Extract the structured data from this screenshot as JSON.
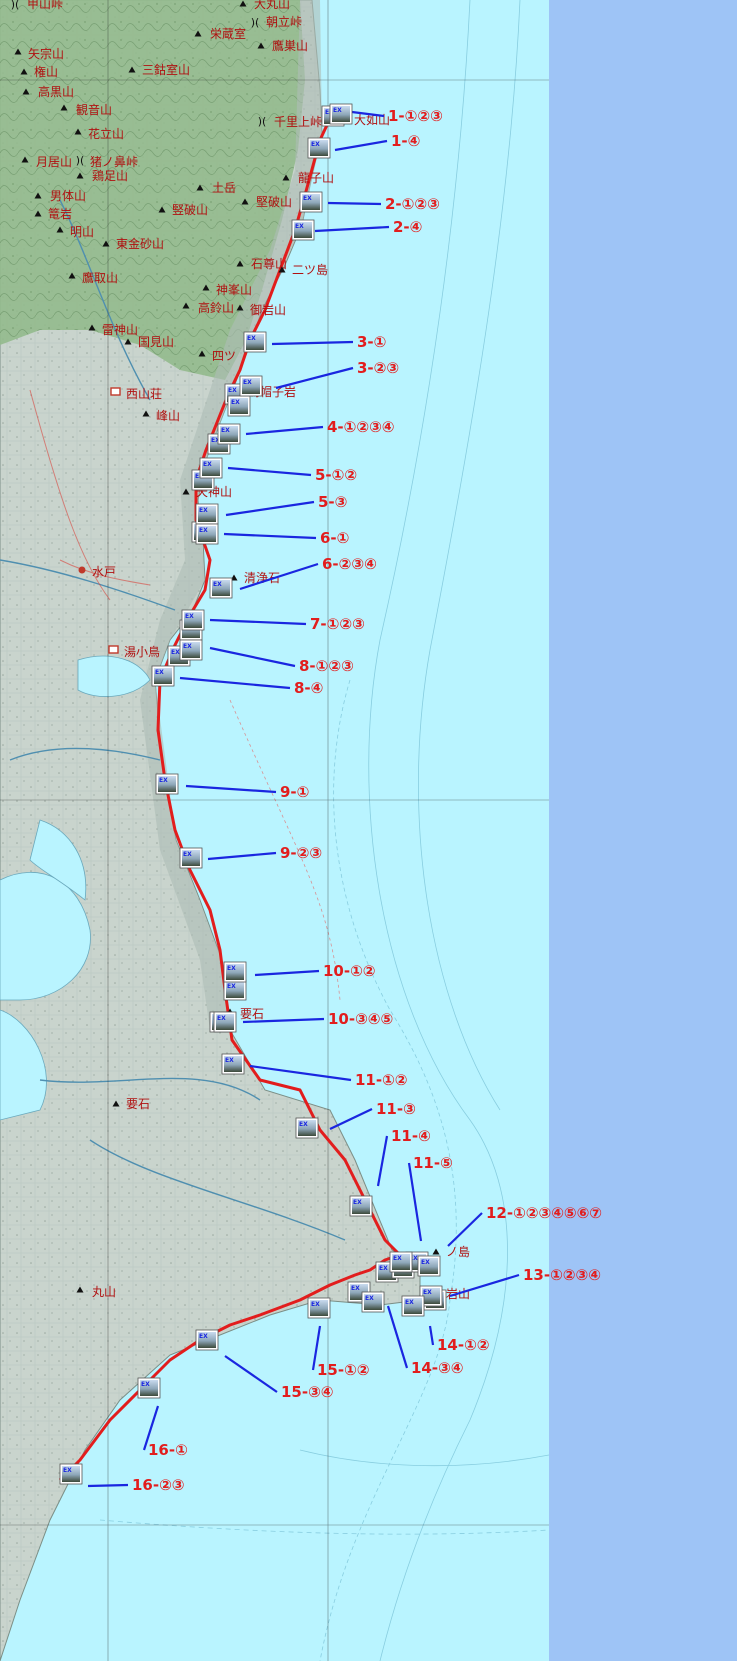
{
  "colors": {
    "ocean": "#b9f4ff",
    "side_panel": "#9ec4f6",
    "land": "#c6d2cc",
    "mountains": "#8fb889",
    "route": "#e21d1d",
    "leader": "#1a26e0",
    "label": "#e21d1d",
    "place": "#b01010"
  },
  "route_legs": [
    {
      "label": "1-①②③"
    },
    {
      "label": "1-④"
    },
    {
      "label": "2-①②③"
    },
    {
      "label": "2-④"
    },
    {
      "label": "3-①"
    },
    {
      "label": "3-②③"
    },
    {
      "label": "4-①②③④"
    },
    {
      "label": "5-①②"
    },
    {
      "label": "5-③"
    },
    {
      "label": "6-①"
    },
    {
      "label": "6-②③④"
    },
    {
      "label": "7-①②③"
    },
    {
      "label": "8-①②③"
    },
    {
      "label": "8-④"
    },
    {
      "label": "9-①"
    },
    {
      "label": "9-②③"
    },
    {
      "label": "10-①②"
    },
    {
      "label": "10-③④⑤"
    },
    {
      "label": "11-①②"
    },
    {
      "label": "11-③"
    },
    {
      "label": "11-④"
    },
    {
      "label": "11-⑤"
    },
    {
      "label": "12-①②③④⑤⑥⑦"
    },
    {
      "label": "13-①②③④"
    },
    {
      "label": "14-①②"
    },
    {
      "label": "14-③④"
    },
    {
      "label": "15-①②"
    },
    {
      "label": "15-③④"
    },
    {
      "label": "16-①"
    },
    {
      "label": "16-②③"
    }
  ],
  "place_names": [
    {
      "name": "甲山峠",
      "icon": "pass-icon"
    },
    {
      "name": "大丸山",
      "icon": "peak-icon"
    },
    {
      "name": "朝立峠",
      "icon": "pass-icon"
    },
    {
      "name": "矢宗山",
      "icon": "peak-icon"
    },
    {
      "name": "栄蔵室",
      "icon": "peak-icon"
    },
    {
      "name": "鷹巣山",
      "icon": "peak-icon"
    },
    {
      "name": "権山",
      "icon": "peak-icon"
    },
    {
      "name": "三鈷室山",
      "icon": "peak-icon"
    },
    {
      "name": "高黒山",
      "icon": "peak-icon"
    },
    {
      "name": "観音山",
      "icon": "peak-icon"
    },
    {
      "name": "千里上峠",
      "icon": "pass-icon"
    },
    {
      "name": "大如山",
      "icon": "peak-icon"
    },
    {
      "name": "花立山",
      "icon": "peak-icon"
    },
    {
      "name": "月居山",
      "icon": "peak-icon"
    },
    {
      "name": "猪ノ鼻峠",
      "icon": "pass-icon"
    },
    {
      "name": "鶏足山",
      "icon": "peak-icon"
    },
    {
      "name": "龍子山",
      "icon": "peak-icon"
    },
    {
      "name": "男体山",
      "icon": "peak-icon"
    },
    {
      "name": "土岳",
      "icon": "peak-icon"
    },
    {
      "name": "竪破山",
      "icon": "peak-icon"
    },
    {
      "name": "堅破山",
      "icon": "peak-icon"
    },
    {
      "name": "篭岩",
      "icon": "peak-icon"
    },
    {
      "name": "明山",
      "icon": "peak-icon"
    },
    {
      "name": "東金砂山",
      "icon": "peak-icon"
    },
    {
      "name": "石尊山",
      "icon": "peak-icon"
    },
    {
      "name": "二ツ島",
      "icon": "peak-icon"
    },
    {
      "name": "鷹取山",
      "icon": "peak-icon"
    },
    {
      "name": "神峯山",
      "icon": "peak-icon"
    },
    {
      "name": "高鈴山",
      "icon": "peak-icon"
    },
    {
      "name": "御岩山",
      "icon": "peak-icon"
    },
    {
      "name": "雷神山",
      "icon": "peak-icon"
    },
    {
      "name": "国見山",
      "icon": "peak-icon"
    },
    {
      "name": "四ツ",
      "icon": "peak-icon"
    },
    {
      "name": "西山荘",
      "icon": "building-icon"
    },
    {
      "name": "烏帽子岩",
      "icon": "rock-icon"
    },
    {
      "name": "峰山",
      "icon": "peak-icon"
    },
    {
      "name": "天神山",
      "icon": "peak-icon"
    },
    {
      "name": "水戸",
      "icon": "city-icon"
    },
    {
      "name": "清浄石",
      "icon": "rock-icon"
    },
    {
      "name": "湯小鳥",
      "icon": "building-icon"
    },
    {
      "name": "要石",
      "icon": "rock-icon"
    },
    {
      "name": "要石",
      "icon": "rock-icon"
    },
    {
      "name": "丸山",
      "icon": "peak-icon"
    },
    {
      "name": "ノ島",
      "icon": "island-icon"
    },
    {
      "name": "岩山",
      "icon": "peak-icon"
    }
  ]
}
